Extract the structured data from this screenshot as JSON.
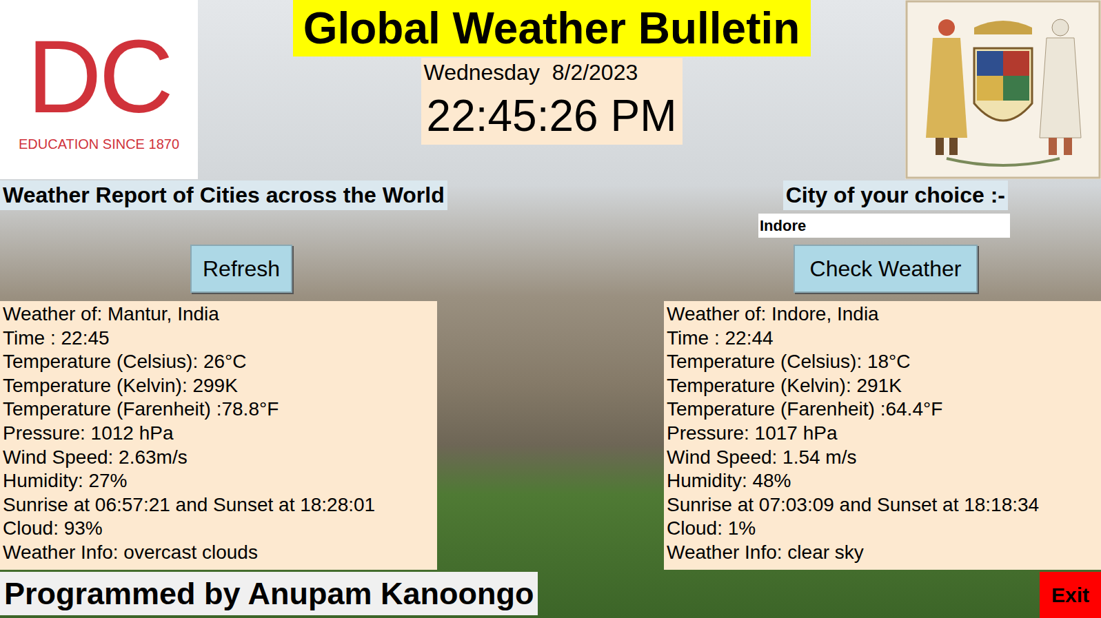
{
  "window": {
    "title": "Global Weather Bulletin"
  },
  "logo": {
    "letters": "DC",
    "tagline": "EDUCATION SINCE 1870"
  },
  "clock": {
    "date": "Wednesday  8/2/2023",
    "time": "22:45:26 PM"
  },
  "sections": {
    "world": "Weather Report of Cities across the World",
    "choice": "City of your choice :-"
  },
  "city_input": {
    "value": "Indore"
  },
  "buttons": {
    "refresh": "Refresh",
    "check": "Check Weather",
    "exit": "Exit"
  },
  "reports": [
    {
      "lines": [
        "Weather of: Mantur, India",
        "Time : 22:45",
        "Temperature (Celsius): 26°C",
        "Temperature (Kelvin): 299K",
        "Temperature (Farenheit) :78.8°F",
        "Pressure: 1012 hPa",
        "Wind Speed: 2.63m/s",
        "Humidity: 27%",
        "Sunrise at 06:57:21 and Sunset at 18:28:01",
        "Cloud: 93%",
        "Weather Info: overcast clouds"
      ]
    },
    {
      "lines": [
        "Weather of: Indore, India",
        "Time : 22:44",
        "Temperature (Celsius): 18°C",
        "Temperature (Kelvin): 291K",
        "Temperature (Farenheit) :64.4°F",
        "Pressure: 1017 hPa",
        "Wind Speed: 1.54 m/s",
        "Humidity: 48%",
        "Sunrise at 07:03:09 and Sunset at 18:18:34",
        "Cloud: 1%",
        "Weather Info: clear sky"
      ]
    }
  ],
  "footer": "Programmed by Anupam Kanoongo"
}
